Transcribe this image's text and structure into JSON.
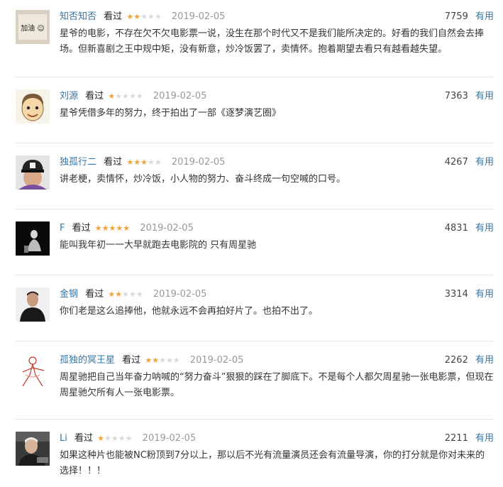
{
  "comments": [
    {
      "user": "知否知否",
      "status": "看过",
      "rating": 2,
      "date": "2019-02-05",
      "votes": "7759",
      "useful_label": "有用",
      "text": "星爷的电影，不存在欠不欠电影票一说，没生在那个时代又不是我们能所决定的。好看的我们自然会去捧场。但新喜剧之王中规中矩，没有新意，炒冷饭罢了，卖情怀。抱着期望去看只有越看越失望。",
      "avatar_text": "加油 ☺",
      "avatar_icon": "avatar-handwritten-icon"
    },
    {
      "user": "刘源",
      "status": "看过",
      "rating": 1,
      "date": "2019-02-05",
      "votes": "7363",
      "useful_label": "有用",
      "text": "星爷凭借多年的努力，终于拍出了一部《逐梦演艺圈》",
      "avatar_icon": "cartoon-face-icon"
    },
    {
      "user": "独孤行二",
      "status": "看过",
      "rating": 3,
      "date": "2019-02-05",
      "votes": "4267",
      "useful_label": "有用",
      "text": "讲老梗，卖情怀，炒冷饭，小人物的努力、奋斗终成一句空喊的口号。",
      "avatar_icon": "cap-photo-icon"
    },
    {
      "user": "F",
      "status": "看过",
      "rating": 5,
      "date": "2019-02-05",
      "votes": "4831",
      "useful_label": "有用",
      "text": "能叫我年初一一大早就跑去电影院的 只有周星驰",
      "avatar_icon": "dark-portrait-icon"
    },
    {
      "user": "金钢",
      "status": "看过",
      "rating": 2,
      "date": "2019-02-05",
      "votes": "3314",
      "useful_label": "有用",
      "text": "你们老是这么追捧他，他就永远不会再拍好片了。也拍不出了。",
      "avatar_icon": "man-portrait-icon"
    },
    {
      "user": "孤独的冥王星",
      "status": "看过",
      "rating": 2,
      "date": "2019-02-05",
      "votes": "2262",
      "useful_label": "有用",
      "text": "周星驰把自己当年奋力呐喊的“努力奋斗”狠狠的踩在了脚底下。不是每个人都欠周星驰一张电影票，但现在周星驰欠所有人一张电影票。",
      "avatar_icon": "sketch-figure-icon"
    },
    {
      "user": "Li",
      "status": "看过",
      "rating": 1,
      "date": "2019-02-05",
      "votes": "2211",
      "useful_label": "有用",
      "text": "如果这种片也能被NC粉顶到7分以上，那以后不光有流量演员还会有流量导演，你的打分就是你对未来的选择！！！",
      "avatar_icon": "elder-portrait-icon"
    }
  ],
  "colors": {
    "link": "#3377aa",
    "star_on": "#f0a33a",
    "star_off": "#d9d9d9",
    "date": "#999999",
    "divider": "#e6e6e6"
  }
}
